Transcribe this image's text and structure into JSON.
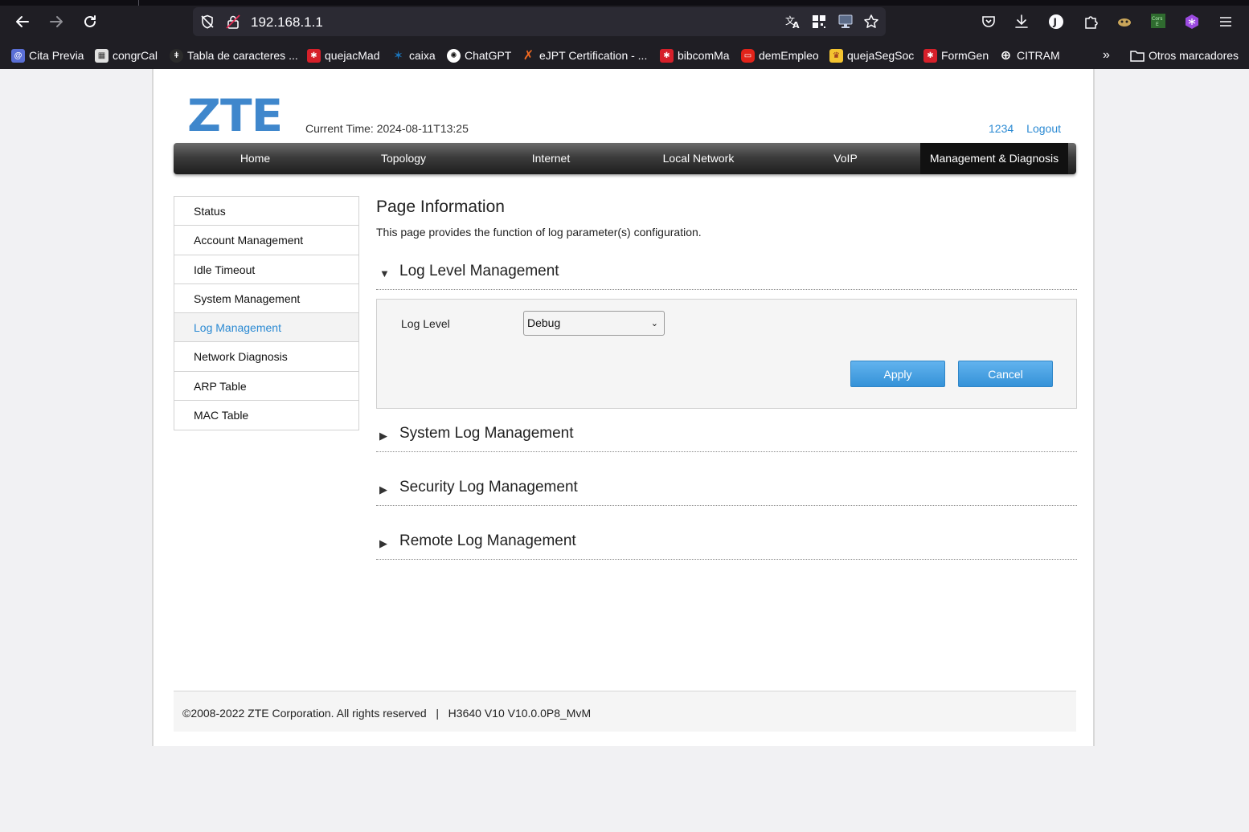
{
  "browser": {
    "url": "192.168.1.1",
    "bookmarks": [
      {
        "label": "Cita Previa",
        "icon": "at-icon",
        "color": "#5a6fd6"
      },
      {
        "label": "congrCal",
        "icon": "calendar-icon",
        "color": "#e0e0e0"
      },
      {
        "label": "Tabla de caracteres ...",
        "icon": "char-table-icon",
        "color": "#2b2b2b"
      },
      {
        "label": "quejacMad",
        "icon": "madrid-icon",
        "color": "#d6202a"
      },
      {
        "label": "caixa",
        "icon": "caixa-star-icon",
        "color": "#1b75bb"
      },
      {
        "label": "ChatGPT",
        "icon": "chatgpt-icon",
        "color": "#ffffff"
      },
      {
        "label": "eJPT Certification - ...",
        "icon": "ine-icon",
        "color": "#f26a21"
      },
      {
        "label": "bibcomMa",
        "icon": "madrid-icon",
        "color": "#d6202a"
      },
      {
        "label": "demEmpleo",
        "icon": "empleo-icon",
        "color": "#e2231a"
      },
      {
        "label": "quejaSegSoc",
        "icon": "seguridad-social-icon",
        "color": "#f4c430"
      },
      {
        "label": "FormGen",
        "icon": "madrid-icon",
        "color": "#d6202a"
      },
      {
        "label": "CITRAM",
        "icon": "globe-icon",
        "color": "#ffffff"
      }
    ],
    "other_bookmarks": "Otros marcadores"
  },
  "header": {
    "logo": "ZTE",
    "current_time": "Current Time: 2024-08-11T13:25",
    "user": "1234",
    "logout": "Logout"
  },
  "nav": {
    "items": [
      "Home",
      "Topology",
      "Internet",
      "Local Network",
      "VoIP",
      "Management & Diagnosis"
    ],
    "active": "Management & Diagnosis"
  },
  "sidebar": {
    "items": [
      "Status",
      "Account Management",
      "Idle Timeout",
      "System Management",
      "Log Management",
      "Network Diagnosis",
      "ARP Table",
      "MAC Table"
    ],
    "active": "Log Management"
  },
  "content": {
    "title": "Page Information",
    "description": "This page provides the function of log parameter(s) configuration.",
    "log_level_section": {
      "title": "Log Level Management",
      "field_label": "Log Level",
      "selected": "Debug",
      "apply": "Apply",
      "cancel": "Cancel"
    },
    "collapsed_sections": [
      "System Log Management",
      "Security Log Management",
      "Remote Log Management"
    ]
  },
  "footer": {
    "copyright": "©2008-2022 ZTE Corporation. All rights reserved",
    "separator": "|",
    "version": "H3640 V10 V10.0.0P8_MvM"
  }
}
